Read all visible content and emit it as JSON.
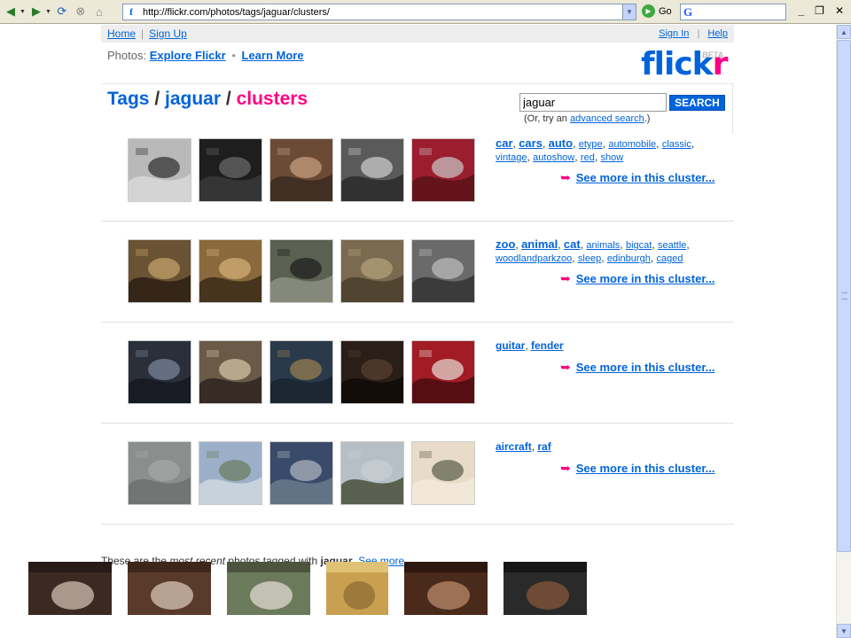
{
  "browser": {
    "url": "http://flickr.com/photos/tags/jaguar/clusters/",
    "go_label": "Go",
    "google_glyph": "G"
  },
  "nav": {
    "home": "Home",
    "signup": "Sign Up",
    "signin": "Sign In",
    "help": "Help",
    "photos_label": "Photos:",
    "explore": "Explore Flickr",
    "learn": "Learn More"
  },
  "logo": {
    "text_main": "flick",
    "text_r": "r",
    "beta": "BETA"
  },
  "breadcrumb": {
    "tags": "Tags",
    "sep": "/",
    "tag": "jaguar",
    "current": "clusters"
  },
  "search": {
    "value": "jaguar",
    "button": "SEARCH",
    "hint_prefix": "(Or, try an ",
    "hint_link": "advanced search",
    "hint_suffix": ".)"
  },
  "see_more_label": "See more in this cluster...",
  "clusters": [
    {
      "tags_line1": [
        "car",
        "cars",
        "auto",
        "etype",
        "automobile",
        "classic"
      ],
      "tags_line2": [
        "vintage",
        "autoshow",
        "red",
        "show"
      ],
      "thumbs": [
        "jaguar-car-grille",
        "black-car-body",
        "hood-ornament",
        "classic-car-front",
        "red-car-ornament"
      ]
    },
    {
      "tags_line1": [
        "zoo",
        "animal",
        "cat",
        "animals",
        "bigcat",
        "seattle"
      ],
      "tags_line2": [
        "woodlandparkzoo",
        "sleep",
        "edinburgh",
        "caged"
      ],
      "thumbs": [
        "jaguar-snarl",
        "jaguar-face",
        "black-jaguar",
        "jaguar-caged",
        "jaguar-sleeping"
      ]
    },
    {
      "tags_line1": [
        "guitar",
        "fender"
      ],
      "tags_line2": [],
      "thumbs": [
        "guitar-strings",
        "guitar-amps",
        "guitar-rack",
        "guitar-player",
        "red-guitar"
      ]
    },
    {
      "tags_line1": [
        "aircraft",
        "raf"
      ],
      "tags_line2": [],
      "thumbs": [
        "plane-in-sky",
        "airfield",
        "jet-display",
        "jet-flying",
        "jet-model"
      ]
    }
  ],
  "recent": {
    "prefix": "These are the ",
    "most_recent": "most recent",
    "middle": " photos tagged with ",
    "tag": "jaguar",
    "dot": ". ",
    "see_more": "See more",
    "ellipsis": "..."
  },
  "colors": {
    "flickr_blue": "#0063dc",
    "flickr_pink": "#ff0084"
  }
}
